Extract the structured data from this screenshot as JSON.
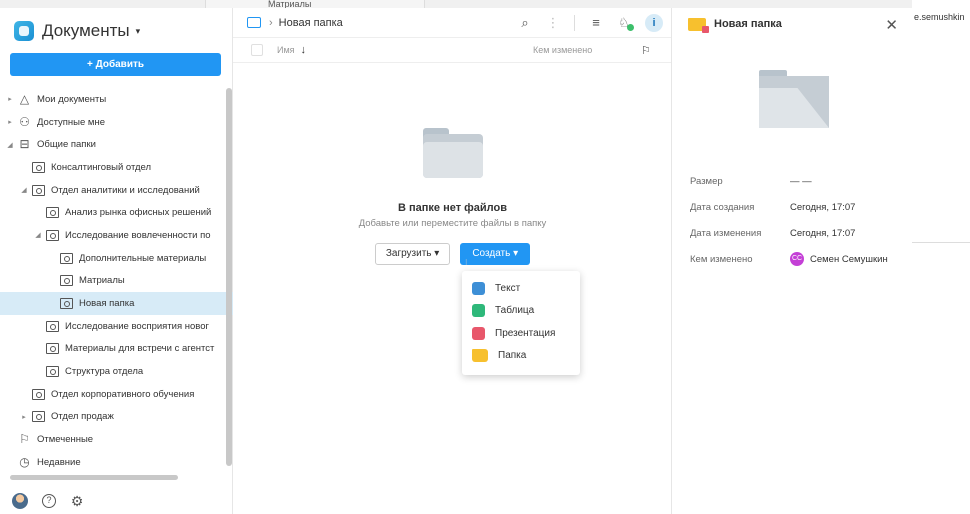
{
  "background": {
    "strip_text": "Матриалы",
    "user_text": "e.semushkin"
  },
  "sidebar": {
    "title": "Документы",
    "add_button": "+ Добавить",
    "items": [
      {
        "label": "Мои документы",
        "indent": 0,
        "arrow": "›",
        "icon": "cloud-icon",
        "glyph": "△"
      },
      {
        "label": "Доступные мне",
        "indent": 0,
        "arrow": "›",
        "icon": "shared-users-icon",
        "glyph": "⚇"
      },
      {
        "label": "Общие папки",
        "indent": 0,
        "arrow": "⌄",
        "icon": "common-folders-icon",
        "glyph": "⊟"
      },
      {
        "label": "Консалтинговый отдел",
        "indent": 1,
        "arrow": "",
        "icon": "room-folder-icon"
      },
      {
        "label": "Отдел аналитики и исследований",
        "indent": 1,
        "arrow": "⌄",
        "icon": "room-folder-icon"
      },
      {
        "label": "Анализ рынка офисных решений",
        "indent": 2,
        "arrow": "",
        "icon": "room-folder-icon"
      },
      {
        "label": "Исследование вовлеченности по",
        "indent": 2,
        "arrow": "⌄",
        "icon": "room-folder-icon"
      },
      {
        "label": "Дополнительные материалы",
        "indent": 3,
        "arrow": "",
        "icon": "room-folder-icon"
      },
      {
        "label": "Матриалы",
        "indent": 3,
        "arrow": "",
        "icon": "room-folder-icon"
      },
      {
        "label": "Новая папка",
        "indent": 3,
        "arrow": "",
        "icon": "room-folder-icon",
        "selected": true
      },
      {
        "label": "Исследование восприятия новог",
        "indent": 2,
        "arrow": "",
        "icon": "room-folder-icon"
      },
      {
        "label": "Материалы для встречи с агентст",
        "indent": 2,
        "arrow": "",
        "icon": "room-folder-icon"
      },
      {
        "label": "Структура отдела",
        "indent": 2,
        "arrow": "",
        "icon": "room-folder-icon"
      },
      {
        "label": "Отдел корпоративного обучения",
        "indent": 1,
        "arrow": "",
        "icon": "room-folder-icon"
      },
      {
        "label": "Отдел продаж",
        "indent": 1,
        "arrow": "›",
        "icon": "room-folder-icon"
      },
      {
        "label": "Отмеченные",
        "indent": 0,
        "arrow": "",
        "icon": "flag-icon",
        "glyph": "⚐"
      },
      {
        "label": "Недавние",
        "indent": 0,
        "arrow": "",
        "icon": "clock-icon",
        "glyph": "◷"
      }
    ]
  },
  "main": {
    "breadcrumb": "Новая папка",
    "col_name": "Имя",
    "col_modified": "Кем изменено",
    "empty_title": "В папке нет файлов",
    "empty_subtitle": "Добавьте или переместите файлы в папку",
    "upload_label": "Загрузить",
    "create_label": "Создать",
    "create_menu": [
      {
        "label": "Текст",
        "kind": "text"
      },
      {
        "label": "Таблица",
        "kind": "table"
      },
      {
        "label": "Презентация",
        "kind": "pres"
      },
      {
        "label": "Папка",
        "kind": "folder"
      }
    ]
  },
  "info": {
    "title": "Новая папка",
    "props": [
      {
        "key": "Размер",
        "value": "— —"
      },
      {
        "key": "Дата создания",
        "value": "Сегодня, 17:07"
      },
      {
        "key": "Дата изменения",
        "value": "Сегодня, 17:07"
      },
      {
        "key": "Кем изменено",
        "value": "Семен Семушкин",
        "avatar": "СС"
      }
    ]
  }
}
